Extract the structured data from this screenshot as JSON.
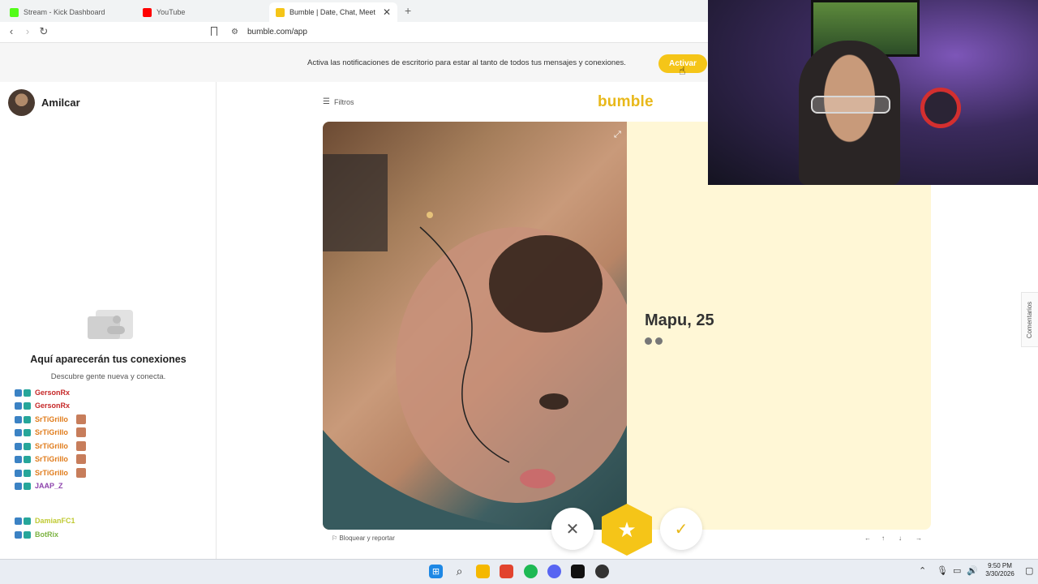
{
  "browser": {
    "tabs": [
      {
        "label": "Stream - Kick Dashboard",
        "favicon_color": "#53fc18"
      },
      {
        "label": "YouTube",
        "favicon_color": "#ff0000"
      },
      {
        "label": "Bumble | Date, Chat, Meet New",
        "favicon_color": "#f5c518",
        "active": true
      }
    ],
    "url": "bumble.com/app",
    "new_tab": "+"
  },
  "banner": {
    "text": "Activa las notificaciones de escritorio para estar al tanto de todos tus mensajes y conexiones.",
    "button_label": "Activar"
  },
  "sidebar": {
    "username": "Amilcar",
    "empty_title": "Aquí aparecerán tus conexiones",
    "empty_subtitle": "Descubre gente nueva y conecta."
  },
  "chat": [
    {
      "user": "GersonRx",
      "color": "#c62828",
      "emote": false
    },
    {
      "user": "GersonRx",
      "color": "#c62828",
      "emote": false
    },
    {
      "user": "SrTiGrillo",
      "color": "#e07b1a",
      "emote": true
    },
    {
      "user": "SrTiGrillo",
      "color": "#e07b1a",
      "emote": true
    },
    {
      "user": "SrTiGrillo",
      "color": "#e07b1a",
      "emote": true
    },
    {
      "user": "SrTiGrillo",
      "color": "#e07b1a",
      "emote": true
    },
    {
      "user": "SrTiGrillo",
      "color": "#e07b1a",
      "emote": true
    },
    {
      "user": "JAAP_Z",
      "color": "#8e44ad",
      "emote": false
    },
    {
      "user": "DamianFC1",
      "color": "#c0ca33",
      "emote": false
    },
    {
      "user": "BotRix",
      "color": "#7cb342",
      "emote": false
    }
  ],
  "main": {
    "filters_label": "Filtros",
    "logo": "bumble",
    "profile_name": "Mapu, 25",
    "report_label": "Bloquear y reportar",
    "comments_label": "Comentarios",
    "nav_hints": [
      "←",
      "↑",
      "↓",
      "→"
    ],
    "buttons": {
      "pass": "✕",
      "superswipe": "★",
      "like": "✓"
    }
  },
  "taskbar": {
    "time": "9:50 PM",
    "date": "3/30/2026",
    "accent": "#f5c518"
  }
}
